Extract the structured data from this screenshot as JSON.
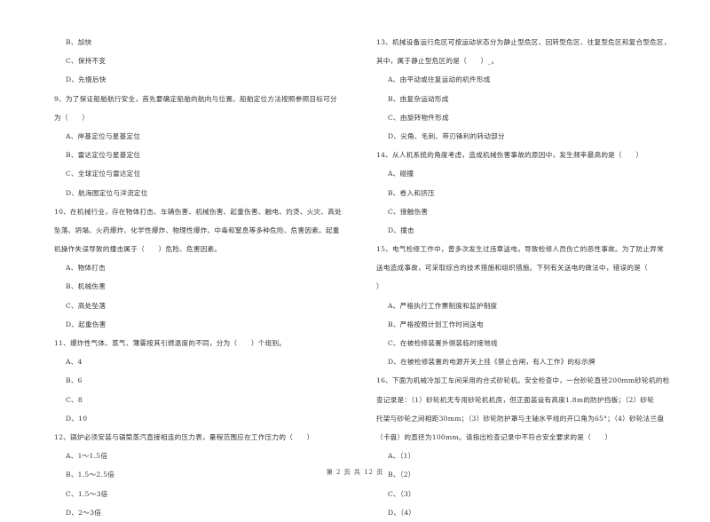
{
  "left_column": [
    {
      "type": "option",
      "text": "B、加快"
    },
    {
      "type": "option",
      "text": "C、保持不变"
    },
    {
      "type": "option",
      "text": "D、先慢后快"
    },
    {
      "type": "question",
      "text": "9、为了保证船舶航行安全，首先要确定船舶的航向与位置。船舶定位方法按照参照目标可分"
    },
    {
      "type": "question",
      "text": "为（　　）"
    },
    {
      "type": "option",
      "text": "A、岸基定位与星基定位"
    },
    {
      "type": "option",
      "text": "B、雷达定位与星基定位"
    },
    {
      "type": "option",
      "text": "C、全球定位与雷达定位"
    },
    {
      "type": "option",
      "text": "D、航海图定位与洋流定位"
    },
    {
      "type": "question",
      "text": "10、在机械行业，存在物体打击、车辆伤害、机械伤害、起重伤害、触电、灼烫、火灾、高处"
    },
    {
      "type": "question",
      "text": "坠落、坍塌、火药爆炸、化学性爆炸、物理性爆炸、中毒和窒息等多种危险、危害因素。起重"
    },
    {
      "type": "question",
      "text": "机操作失误导致的撞击属于（　　）危险、危害因素。"
    },
    {
      "type": "option",
      "text": "A、物体打击"
    },
    {
      "type": "option",
      "text": "B、机械伤害"
    },
    {
      "type": "option",
      "text": "C、高处坠落"
    },
    {
      "type": "option",
      "text": "D、起重伤害"
    },
    {
      "type": "question",
      "text": "11、爆炸性气体、蒸气、薄雾按其引燃温度的不同，分为（　　）个组别。"
    },
    {
      "type": "option",
      "text": "A、4"
    },
    {
      "type": "option",
      "text": "B、6"
    },
    {
      "type": "option",
      "text": "C、8"
    },
    {
      "type": "option",
      "text": "D、10"
    },
    {
      "type": "question",
      "text": "12、锅炉必须安装与锅筒蒸汽直接相连的压力表，量程范围应在工作压力的（　　）"
    },
    {
      "type": "option",
      "text": "A、1～1.5倍"
    },
    {
      "type": "option",
      "text": "B、1.5～2.5倍"
    },
    {
      "type": "option",
      "text": "C、1.5～3倍"
    },
    {
      "type": "option",
      "text": "D、2～3倍"
    }
  ],
  "right_column": [
    {
      "type": "question",
      "text": "13、机械设备运行危区可按运动状态分为静止型危区、回转型危区、往复型危区和复合型危区，"
    },
    {
      "type": "question",
      "text": "其中，属于静止型危区的是（　　）_。"
    },
    {
      "type": "option",
      "text": "A、由平动或往复运动的机件形成"
    },
    {
      "type": "option",
      "text": "B、由复杂运动形成"
    },
    {
      "type": "option",
      "text": "C、由旋转物件形成"
    },
    {
      "type": "option",
      "text": "D、尖角、毛刺、带刃锋利的转动部分"
    },
    {
      "type": "question",
      "text": "14、从人机系统的角度考虑，造成机械伤害事故的原因中，发生频率最高的是（　　）"
    },
    {
      "type": "option",
      "text": "A、碰撞"
    },
    {
      "type": "option",
      "text": "B、卷入和挤压"
    },
    {
      "type": "option",
      "text": "C、接触伤害"
    },
    {
      "type": "option",
      "text": "D、撞击"
    },
    {
      "type": "question",
      "text": "15、电气检修工作中，曾多次发生过违章送电，导致检修人员伤亡的恶性事故。为了防止异常"
    },
    {
      "type": "question",
      "text": "送电造成事故，可采取综合的技术措施和组织措施。下列有关送电的做法中，错误的是（"
    },
    {
      "type": "question",
      "text": "）"
    },
    {
      "type": "option",
      "text": "A、严格执行工作票制度和监护制度"
    },
    {
      "type": "option",
      "text": "B、严格按照计划工作时间送电"
    },
    {
      "type": "option",
      "text": "C、在被检修装置外侧装临时接地线"
    },
    {
      "type": "option",
      "text": "D、在被检修装置的电源开关上挂《禁止合闸，有人工作》的标示牌"
    },
    {
      "type": "question",
      "text": "16、下面为机械冷加工车间采用的合式砂轮机。安全检查中，一台砂轮直径200mm砂轮机的检"
    },
    {
      "type": "question",
      "text": "查记录是：（1）砂轮机无专用砂轮机机房，但正面装设有高度1.8m的防护挡板；（2）砂轮"
    },
    {
      "type": "question",
      "text": "托架与砂轮之间相距30mm；（3）砂轮防护罩与主轴水平线的开口角为65°；（4）砂轮法兰盘"
    },
    {
      "type": "question",
      "text": "（卡盘）的直径为100mm。请指出检查记录中不符合安全要求的是（　　）"
    },
    {
      "type": "option",
      "text": "A、（1）"
    },
    {
      "type": "option",
      "text": "B、（2）"
    },
    {
      "type": "option",
      "text": "C、（3）"
    },
    {
      "type": "option",
      "text": "D、（4）"
    }
  ],
  "footer": {
    "page_text": "第 2 页 共 12 页"
  }
}
